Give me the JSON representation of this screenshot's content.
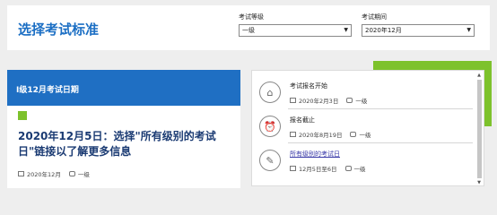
{
  "header": {
    "title": "选择考试标准",
    "level_label": "考试等级",
    "level_value": "一级",
    "time_label": "考试期间",
    "time_value": "2020年12月"
  },
  "left_card": {
    "heading": "I级12月考试日期",
    "headline": "2020年12月5日：选择\"所有级别的考试日\"链接以了解更多信息",
    "date": "2020年12月",
    "level": "一级"
  },
  "timeline": [
    {
      "title": "考试报名开始",
      "date": "2020年2月3日",
      "level": "一级",
      "icon": "tag-icon",
      "link": false
    },
    {
      "title": "报名截止",
      "date": "2020年8月19日",
      "level": "一级",
      "icon": "alarm-clock-icon",
      "link": false
    },
    {
      "title": "所有级别的考试日",
      "date": "12月5日至6日",
      "level": "一级",
      "icon": "pencil-edit-icon",
      "link": true
    }
  ],
  "colors": {
    "brand_blue": "#1f6fc3",
    "accent_green": "#7dc22c"
  }
}
